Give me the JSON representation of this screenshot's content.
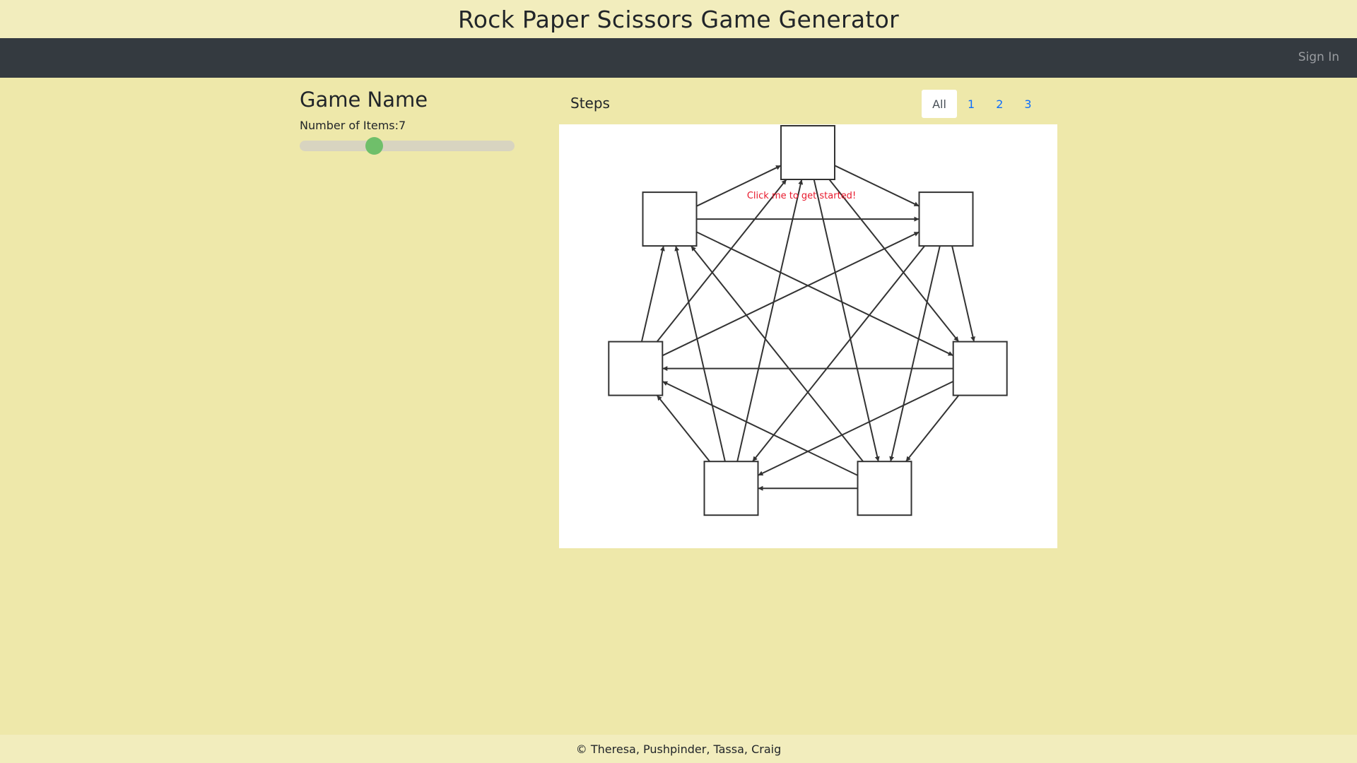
{
  "header": {
    "title": "Rock Paper Scissors Game Generator"
  },
  "navbar": {
    "sign_in_label": "Sign In"
  },
  "left_panel": {
    "game_name_heading": "Game Name",
    "items_label": "Number of Items:7",
    "items_count": 7,
    "slider_color": "#6fbf6a"
  },
  "steps": {
    "heading": "Steps",
    "tabs": [
      {
        "label": "All",
        "active": true
      },
      {
        "label": "1",
        "active": false
      },
      {
        "label": "2",
        "active": false
      },
      {
        "label": "3",
        "active": false
      }
    ]
  },
  "graph": {
    "get_started_text": "Click me to get started!",
    "get_started_color": "#e8192c",
    "node_count": 7
  },
  "footer": {
    "text": "© Theresa, Pushpinder, Tassa, Craig"
  }
}
